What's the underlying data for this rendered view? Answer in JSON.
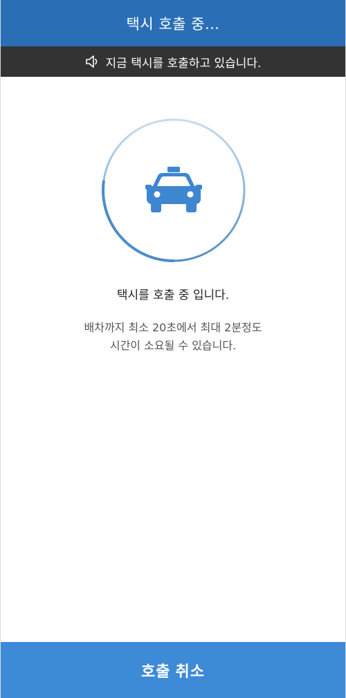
{
  "header": {
    "title": "택시 호출 중..."
  },
  "notice": {
    "icon": "speaker-icon",
    "text": "지금 택시를 호출하고 있습니다."
  },
  "progress": {
    "fraction": 0.27,
    "icon": "taxi-icon"
  },
  "status": {
    "message": "택시를 호출 중 입니다."
  },
  "info": {
    "line1": "배차까지 최소 20초에서 최대 2분정도",
    "line2": "시간이 소요될 수 있습니다."
  },
  "footer": {
    "cancel_label": "호출 취소"
  },
  "colors": {
    "header_bg": "#2a6fb6",
    "notice_bg": "#333333",
    "ring_light": "#bcd3e8",
    "ring_dark": "#4d8cc9",
    "taxi": "#3f86d0",
    "button_bg": "#3d8ad6"
  }
}
